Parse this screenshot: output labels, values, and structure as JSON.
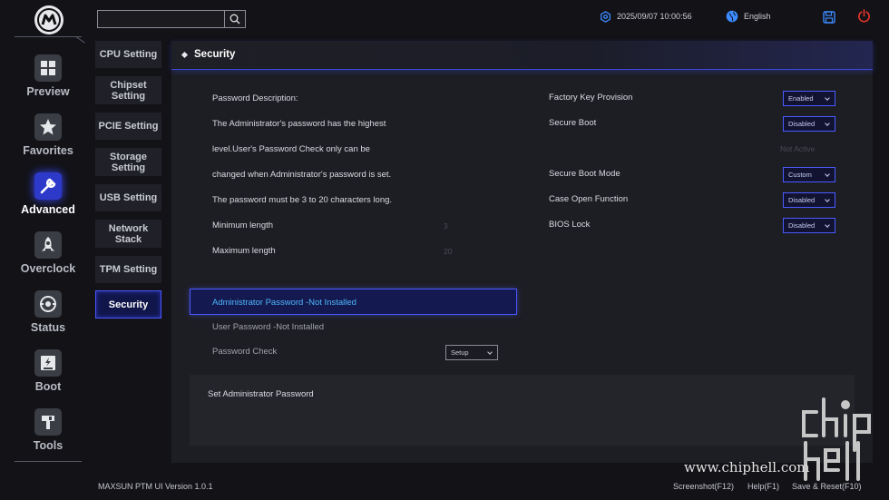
{
  "header": {
    "search_placeholder": "",
    "datetime": "2025/09/07 10:00:56",
    "language": "English"
  },
  "rail": {
    "items": [
      {
        "label": "Preview"
      },
      {
        "label": "Favorites"
      },
      {
        "label": "Advanced"
      },
      {
        "label": "Overclock"
      },
      {
        "label": "Status"
      },
      {
        "label": "Boot"
      },
      {
        "label": "Tools"
      }
    ],
    "active": "Advanced"
  },
  "submenu": {
    "items": [
      {
        "label": "CPU Setting"
      },
      {
        "label": "Chipset Setting"
      },
      {
        "label": "PCIE Setting"
      },
      {
        "label": "Storage Setting"
      },
      {
        "label": "USB Setting"
      },
      {
        "label": "Network Stack"
      },
      {
        "label": "TPM Setting"
      },
      {
        "label": "Security"
      }
    ],
    "active": "Security"
  },
  "panel": {
    "title": "Security",
    "description": [
      "Password Description:",
      "The Administrator's password has the highest",
      "level.User's Password Check only can be",
      "changed when Administrator's password is set.",
      "The password must be 3 to 20 characters long."
    ],
    "min_length_label": "Minimum length",
    "min_length_value": "3",
    "max_length_label": "Maximum length",
    "max_length_value": "20",
    "admin_password": "Administrator Password -Not Installed",
    "user_password": "User Password -Not Installed",
    "password_check_label": "Password Check",
    "password_check_value": "Setup",
    "right": {
      "factory_key_label": "Factory Key Provision",
      "factory_key_value": "Enabled",
      "secure_boot_label": "Secure Boot",
      "secure_boot_value": "Disabled",
      "secure_boot_status": "Not Active",
      "secure_boot_mode_label": "Secure Boot Mode",
      "secure_boot_mode_value": "Custom",
      "case_open_label": "Case Open Function",
      "case_open_value": "Disabled",
      "bios_lock_label": "BIOS Lock",
      "bios_lock_value": "Disabled"
    },
    "help_text": "Set Administrator Password"
  },
  "footer": {
    "version": "MAXSUN PTM UI Version 1.0.1",
    "screenshot": "Screenshot(F12)",
    "help": "Help(F1)",
    "save_reset": "Save & Reset(F10)"
  },
  "watermark": {
    "url": "www.chiphell.com",
    "logo_text": "chip hell"
  },
  "colors": {
    "accent": "#4a57ff",
    "active_text": "#4fb6ff",
    "power": "#e0332b",
    "save_icon": "#3d8bff"
  }
}
